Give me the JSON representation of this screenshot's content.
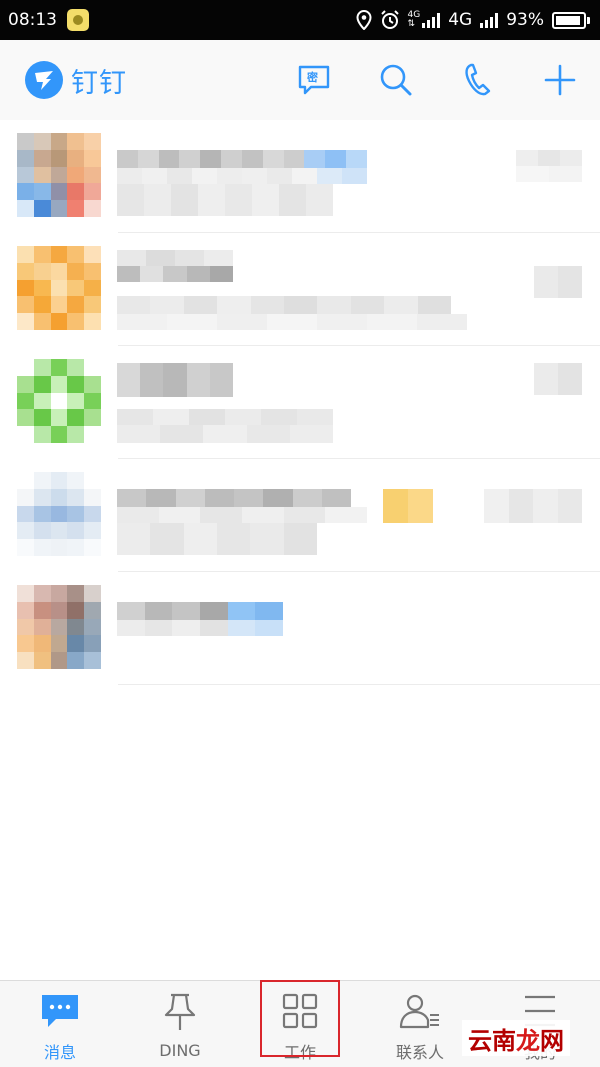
{
  "status_bar": {
    "time": "08:13",
    "network_small_top": "4G",
    "network_small_bottom": "⇅",
    "network": "4G",
    "battery_percent": "93%",
    "battery_level": 0.93,
    "icons": [
      "app-notification-icon",
      "location-icon",
      "alarm-icon",
      "signal-icon",
      "battery-icon"
    ]
  },
  "header": {
    "app_name": "钉钉",
    "secret_chat_label": "密",
    "actions": [
      "secret-chat-icon",
      "search-icon",
      "phone-icon",
      "add-icon"
    ]
  },
  "bottom_nav": {
    "tabs": [
      {
        "label": "消息",
        "icon": "message-icon",
        "active": true
      },
      {
        "label": "DING",
        "icon": "pin-icon",
        "active": false
      },
      {
        "label": "工作",
        "icon": "grid-icon",
        "active": false
      },
      {
        "label": "联系人",
        "icon": "contacts-icon",
        "active": false
      },
      {
        "label": "我的",
        "icon": "menu-icon",
        "active": false
      }
    ]
  },
  "watermark": {
    "part1": "云南",
    "part2": "龙",
    "part3": "网"
  },
  "colors": {
    "accent": "#3296fa",
    "highlight": "#d9262c"
  }
}
